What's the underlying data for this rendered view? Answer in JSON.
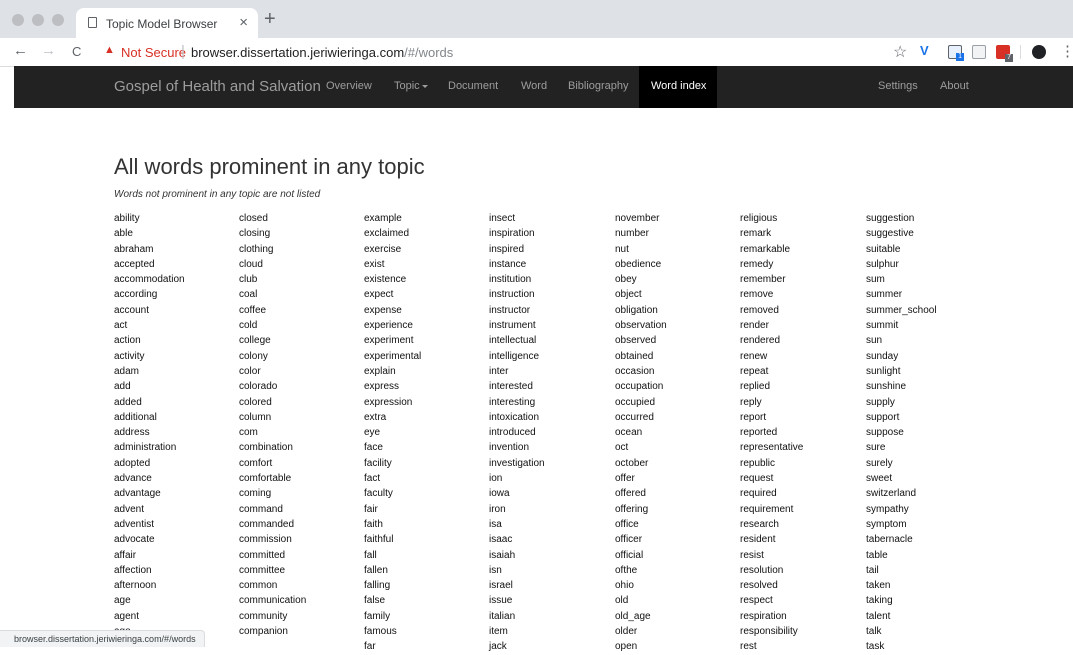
{
  "browser": {
    "tab_title": "Topic Model Browser",
    "tab_close": "×",
    "new_tab": "+",
    "back": "←",
    "forward": "→",
    "reload": "C",
    "security_label": "Not Secure",
    "url_host": "browser.dissertation.jeriwieringa.com",
    "url_path": "/#/words",
    "ext_badge_1": "1",
    "ext_badge_2": "7",
    "status_url": "browser.dissertation.jeriwieringa.com/#/words",
    "icons": [
      "back-arrow-icon",
      "forward-arrow-icon",
      "reload-icon",
      "warning-icon",
      "star-icon",
      "extension-icon",
      "menu-icon"
    ]
  },
  "navbar": {
    "brand": "Gospel of Health and Salvation",
    "overview": "Overview",
    "topic": "Topic",
    "document": "Document",
    "word": "Word",
    "bibliography": "Bibliography",
    "word_index": "Word index",
    "settings": "Settings",
    "about": "About"
  },
  "page": {
    "title": "All words prominent in any topic",
    "subtitle": "Words not prominent in any topic are not listed"
  },
  "word_columns": [
    [
      "ability",
      "able",
      "abraham",
      "accepted",
      "accommodation",
      "according",
      "account",
      "act",
      "action",
      "activity",
      "adam",
      "add",
      "added",
      "additional",
      "address",
      "administration",
      "adopted",
      "advance",
      "advantage",
      "advent",
      "adventist",
      "advocate",
      "affair",
      "affection",
      "afternoon",
      "age",
      "agent",
      "ago"
    ],
    [
      "closed",
      "closing",
      "clothing",
      "cloud",
      "club",
      "coal",
      "coffee",
      "cold",
      "college",
      "colony",
      "color",
      "colorado",
      "colored",
      "column",
      "com",
      "combination",
      "comfort",
      "comfortable",
      "coming",
      "command",
      "commanded",
      "commission",
      "committed",
      "committee",
      "common",
      "communication",
      "community",
      "companion"
    ],
    [
      "example",
      "exclaimed",
      "exercise",
      "exist",
      "existence",
      "expect",
      "expense",
      "experience",
      "experiment",
      "experimental",
      "explain",
      "express",
      "expression",
      "extra",
      "eye",
      "face",
      "facility",
      "fact",
      "faculty",
      "fair",
      "faith",
      "faithful",
      "fall",
      "fallen",
      "falling",
      "false",
      "family",
      "famous",
      "far"
    ],
    [
      "insect",
      "inspiration",
      "inspired",
      "instance",
      "institution",
      "instruction",
      "instructor",
      "instrument",
      "intellectual",
      "intelligence",
      "inter",
      "interested",
      "interesting",
      "intoxication",
      "introduced",
      "invention",
      "investigation",
      "ion",
      "iowa",
      "iron",
      "isa",
      "isaac",
      "isaiah",
      "isn",
      "israel",
      "issue",
      "italian",
      "item",
      "jack"
    ],
    [
      "november",
      "number",
      "nut",
      "obedience",
      "obey",
      "object",
      "obligation",
      "observation",
      "observed",
      "obtained",
      "occasion",
      "occupation",
      "occupied",
      "occurred",
      "ocean",
      "oct",
      "october",
      "offer",
      "offered",
      "offering",
      "office",
      "officer",
      "official",
      "ofthe",
      "ohio",
      "old",
      "old_age",
      "older",
      "open"
    ],
    [
      "religious",
      "remark",
      "remarkable",
      "remedy",
      "remember",
      "remove",
      "removed",
      "render",
      "rendered",
      "renew",
      "repeat",
      "replied",
      "reply",
      "report",
      "reported",
      "representative",
      "republic",
      "request",
      "required",
      "requirement",
      "research",
      "resident",
      "resist",
      "resolution",
      "resolved",
      "respect",
      "respiration",
      "responsibility",
      "rest"
    ],
    [
      "suggestion",
      "suggestive",
      "suitable",
      "sulphur",
      "sum",
      "summer",
      "summer_school",
      "summit",
      "sun",
      "sunday",
      "sunlight",
      "sunshine",
      "supply",
      "support",
      "suppose",
      "sure",
      "surely",
      "sweet",
      "switzerland",
      "sympathy",
      "symptom",
      "tabernacle",
      "table",
      "tail",
      "taken",
      "taking",
      "talent",
      "talk",
      "task"
    ]
  ]
}
